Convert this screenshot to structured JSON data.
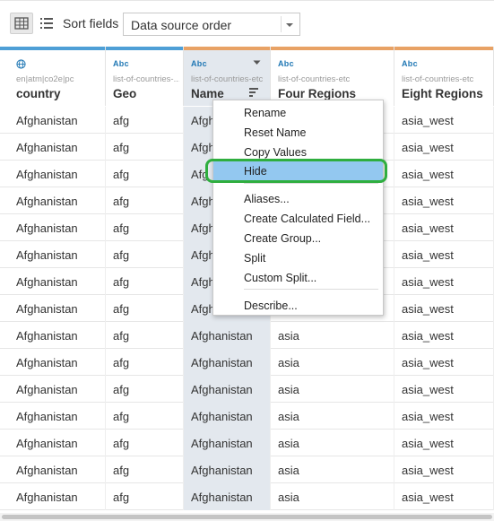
{
  "toolbar": {
    "sort_label": "Sort fields",
    "sort_value": "Data source order"
  },
  "columns": [
    {
      "type": "",
      "source": "en|atm|co2e|pc",
      "name": "country",
      "topbar_color": "#4e9fd6"
    },
    {
      "type": "Abc",
      "source": "list-of-countries-...",
      "name": "Geo",
      "topbar_color": "#4e9fd6"
    },
    {
      "type": "Abc",
      "source": "list-of-countries-etc",
      "name": "Name",
      "topbar_color": "#e8a265"
    },
    {
      "type": "Abc",
      "source": "list-of-countries-etc",
      "name": "Four Regions",
      "topbar_color": "#e8a265"
    },
    {
      "type": "Abc",
      "source": "list-of-countries-etc",
      "name": "Eight Regions",
      "topbar_color": "#e8a265"
    }
  ],
  "rows": [
    [
      "Afghanistan",
      "afg",
      "Afgh",
      "",
      "asia_west"
    ],
    [
      "Afghanistan",
      "afg",
      "Afgh",
      "",
      "asia_west"
    ],
    [
      "Afghanistan",
      "afg",
      "Afg",
      "",
      "asia_west"
    ],
    [
      "Afghanistan",
      "afg",
      "Afgh",
      "",
      "asia_west"
    ],
    [
      "Afghanistan",
      "afg",
      "Afgh",
      "",
      "asia_west"
    ],
    [
      "Afghanistan",
      "afg",
      "Afgh",
      "",
      "asia_west"
    ],
    [
      "Afghanistan",
      "afg",
      "Afgh",
      "",
      "asia_west"
    ],
    [
      "Afghanistan",
      "afg",
      "Afgh",
      "",
      "asia_west"
    ],
    [
      "Afghanistan",
      "afg",
      "Afghanistan",
      "asia",
      "asia_west"
    ],
    [
      "Afghanistan",
      "afg",
      "Afghanistan",
      "asia",
      "asia_west"
    ],
    [
      "Afghanistan",
      "afg",
      "Afghanistan",
      "asia",
      "asia_west"
    ],
    [
      "Afghanistan",
      "afg",
      "Afghanistan",
      "asia",
      "asia_west"
    ],
    [
      "Afghanistan",
      "afg",
      "Afghanistan",
      "asia",
      "asia_west"
    ],
    [
      "Afghanistan",
      "afg",
      "Afghanistan",
      "asia",
      "asia_west"
    ],
    [
      "Afghanistan",
      "afg",
      "Afghanistan",
      "asia",
      "asia_west"
    ]
  ],
  "context_menu": {
    "items": [
      "Rename",
      "Reset Name",
      "Copy Values",
      "Hide",
      "Aliases...",
      "Create Calculated Field...",
      "Create Group...",
      "Split",
      "Custom Split...",
      "Describe..."
    ],
    "highlighted": "Hide"
  },
  "colors": {
    "selected_column": "#e3e8ee",
    "menu_highlight": "#93c8f0",
    "annotation_ring": "#2fae3f",
    "type_icon": "#1f77b4"
  },
  "icons": {
    "grid_view": "grid-view-icon",
    "list_view": "list-view-icon",
    "geo_type": "globe-icon",
    "dropdown": "chevron-down-icon",
    "sort": "sort-icon"
  }
}
